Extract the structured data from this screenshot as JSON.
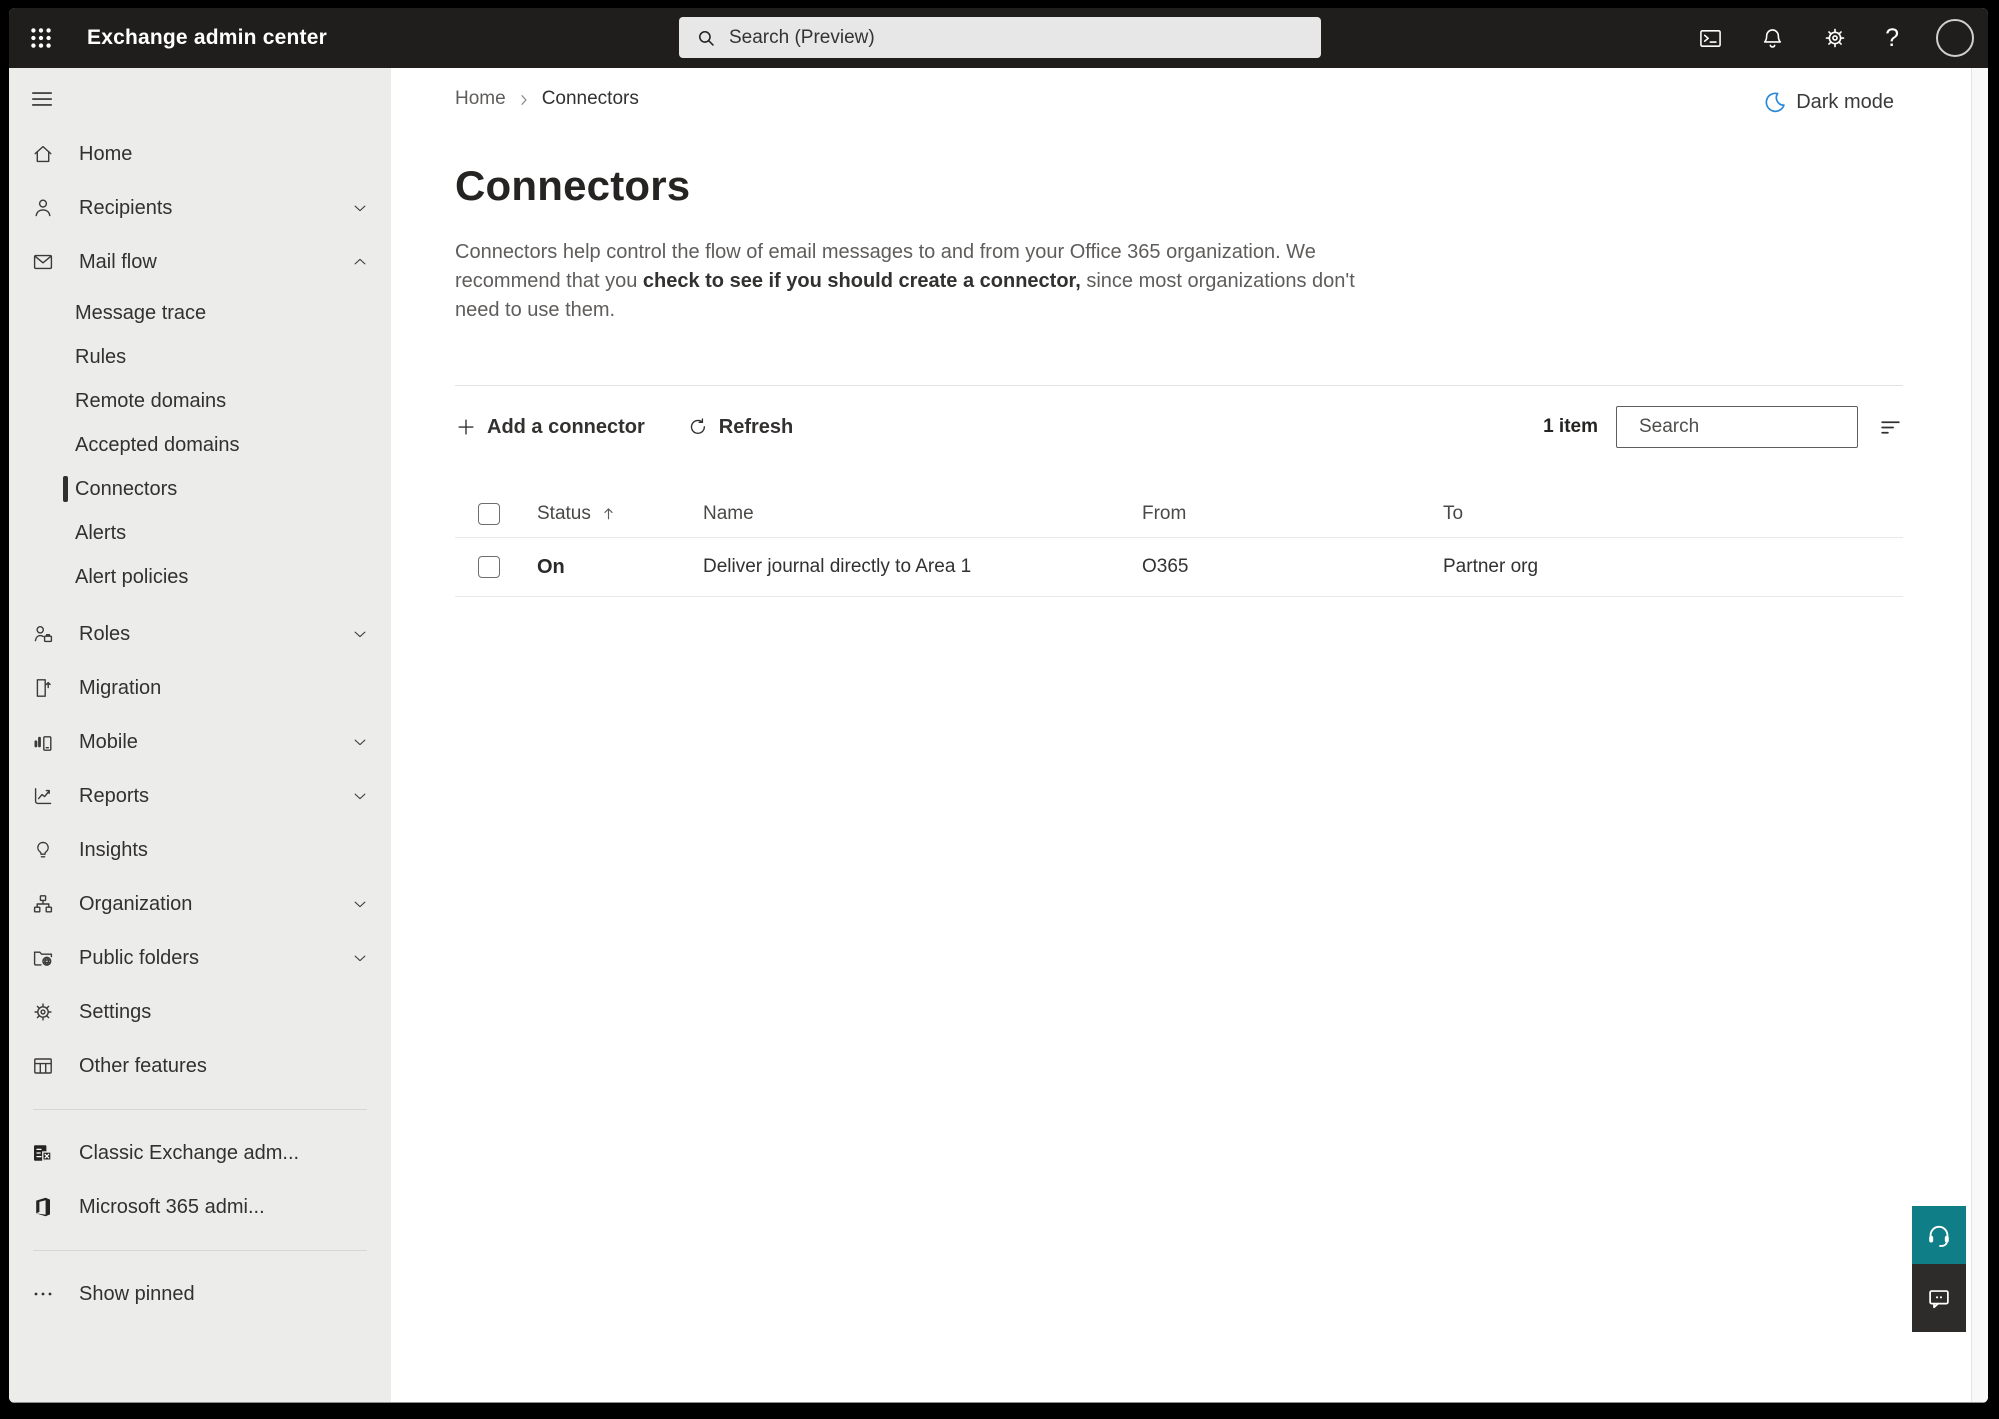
{
  "topbar": {
    "title": "Exchange admin center",
    "search_placeholder": "Search (Preview)"
  },
  "breadcrumb": {
    "home": "Home",
    "current": "Connectors"
  },
  "theme_toggle": {
    "label": "Dark mode"
  },
  "sidebar": {
    "items": [
      {
        "label": "Home",
        "icon": "home-icon"
      },
      {
        "label": "Recipients",
        "icon": "person-icon",
        "expandable": true
      },
      {
        "label": "Mail flow",
        "icon": "mail-icon",
        "expandable": true,
        "expanded": true,
        "children": [
          {
            "label": "Message trace"
          },
          {
            "label": "Rules"
          },
          {
            "label": "Remote domains"
          },
          {
            "label": "Accepted domains"
          },
          {
            "label": "Connectors",
            "selected": true
          },
          {
            "label": "Alerts"
          },
          {
            "label": "Alert policies"
          }
        ]
      },
      {
        "label": "Roles",
        "icon": "roles-icon",
        "expandable": true
      },
      {
        "label": "Migration",
        "icon": "migration-icon"
      },
      {
        "label": "Mobile",
        "icon": "mobile-icon",
        "expandable": true
      },
      {
        "label": "Reports",
        "icon": "reports-icon",
        "expandable": true
      },
      {
        "label": "Insights",
        "icon": "insights-icon"
      },
      {
        "label": "Organization",
        "icon": "organization-icon",
        "expandable": true
      },
      {
        "label": "Public folders",
        "icon": "public-folders-icon",
        "expandable": true
      },
      {
        "label": "Settings",
        "icon": "settings-icon"
      },
      {
        "label": "Other features",
        "icon": "other-features-icon"
      }
    ],
    "footer_items": [
      {
        "label": "Classic Exchange adm...",
        "icon": "exchange-logo-icon"
      },
      {
        "label": "Microsoft 365 admi...",
        "icon": "m365-logo-icon"
      }
    ],
    "show_pinned": "Show pinned"
  },
  "page": {
    "title": "Connectors",
    "description": {
      "line1": "Connectors help control the flow of email messages to and from your Office 365 organization. We",
      "line2_pre": "recommend that you ",
      "line2_bold": "check to see if you should create a connector,",
      "line2_post": " since most organizations don't",
      "line3": "need to use them."
    }
  },
  "toolbar": {
    "add_button": "Add a connector",
    "refresh_button": "Refresh",
    "item_count": "1 item",
    "search_placeholder": "Search"
  },
  "table": {
    "headers": {
      "status": "Status",
      "name": "Name",
      "from": "From",
      "to": "To"
    },
    "rows": [
      {
        "status": "On",
        "name": "Deliver journal directly to Area 1",
        "from": "O365",
        "to": "Partner org"
      }
    ]
  },
  "colors": {
    "topbar_bg": "#1f1e1d",
    "sidebar_bg": "#ececeb",
    "moon_accent": "#2b88d8",
    "help_button": "#0f7e87",
    "feedback_button": "#2d2c2b"
  }
}
